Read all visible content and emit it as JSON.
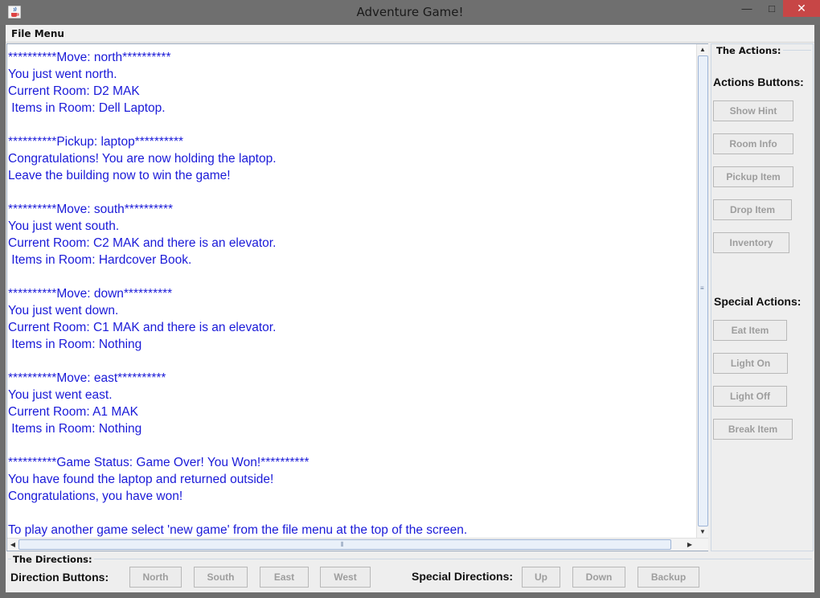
{
  "window": {
    "title": "Adventure Game!",
    "minimize_glyph": "—",
    "maximize_glyph": "□",
    "close_glyph": "✕",
    "icon": "java-cup-icon"
  },
  "menu": {
    "file_menu_label": "File Menu"
  },
  "output_lines": [
    "**********Move: north**********",
    "You just went north.",
    "Current Room: D2 MAK",
    " Items in Room: Dell Laptop.",
    "",
    "**********Pickup: laptop**********",
    "Congratulations! You are now holding the laptop.",
    "Leave the building now to win the game!",
    "",
    "**********Move: south**********",
    "You just went south.",
    "Current Room: C2 MAK and there is an elevator.",
    " Items in Room: Hardcover Book.",
    "",
    "**********Move: down**********",
    "You just went down.",
    "Current Room: C1 MAK and there is an elevator.",
    " Items in Room: Nothing",
    "",
    "**********Move: east**********",
    "You just went east.",
    "Current Room: A1 MAK",
    " Items in Room: Nothing",
    "",
    "**********Game Status: Game Over! You Won!**********",
    "You have found the laptop and returned outside!",
    "Congratulations, you have won!",
    "",
    "To play another game select 'new game' from the file menu at the top of the screen."
  ],
  "actions_panel": {
    "title": "The Actions:",
    "actions_heading": "Actions Buttons:",
    "action_buttons": [
      "Show Hint",
      "Room Info",
      "Pickup Item",
      "Drop Item",
      "Inventory"
    ],
    "special_heading": "Special Actions:",
    "special_buttons": [
      "Eat Item",
      "Light On",
      "Light Off",
      "Break Item"
    ]
  },
  "directions_panel": {
    "title": "The Directions:",
    "direction_label": "Direction Buttons:",
    "direction_buttons": [
      "North",
      "South",
      "East",
      "West"
    ],
    "special_label": "Special Directions:",
    "special_buttons": [
      "Up",
      "Down",
      "Backup"
    ]
  },
  "colors": {
    "output_text": "#1a1ad8",
    "disabled_button_text": "#9d9d9d",
    "close_button": "#c74646"
  }
}
